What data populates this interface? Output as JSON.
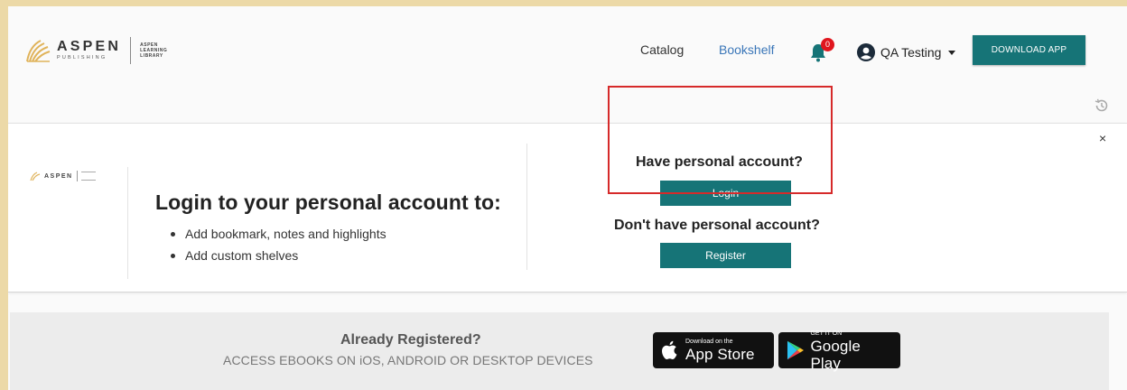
{
  "header": {
    "logo": {
      "name": "ASPEN",
      "sub": "PUBLISHING",
      "library_lines": [
        "ASPEN",
        "LEARNING",
        "LIBRARY"
      ]
    },
    "nav": {
      "catalog": "Catalog",
      "bookshelf": "Bookshelf"
    },
    "notifications": {
      "count": "0"
    },
    "user": {
      "name": "QA Testing"
    },
    "download_app_label": "DOWNLOAD APP"
  },
  "banner": {
    "mini_logo": {
      "name": "ASPEN"
    },
    "promo_title": "Login to your personal account to:",
    "promo_items": [
      "Add bookmark, notes and highlights",
      "Add custom shelves"
    ],
    "have_account_title": "Have personal account?",
    "login_label": "Login",
    "no_account_title": "Don't have personal account?",
    "register_label": "Register",
    "close_label": "×"
  },
  "footer": {
    "already_registered": "Already Registered?",
    "access_text": "ACCESS EBOOKS ON iOS, ANDROID OR DESKTOP DEVICES",
    "app_store": {
      "small": "Download on the",
      "big": "App Store"
    },
    "google_play": {
      "small": "GET IT ON",
      "big": "Google Play"
    }
  },
  "colors": {
    "accent": "#167477",
    "link": "#3a76b8",
    "badge": "#e0161e",
    "highlight": "#d62a2a",
    "frame": "#ecd9a7"
  }
}
